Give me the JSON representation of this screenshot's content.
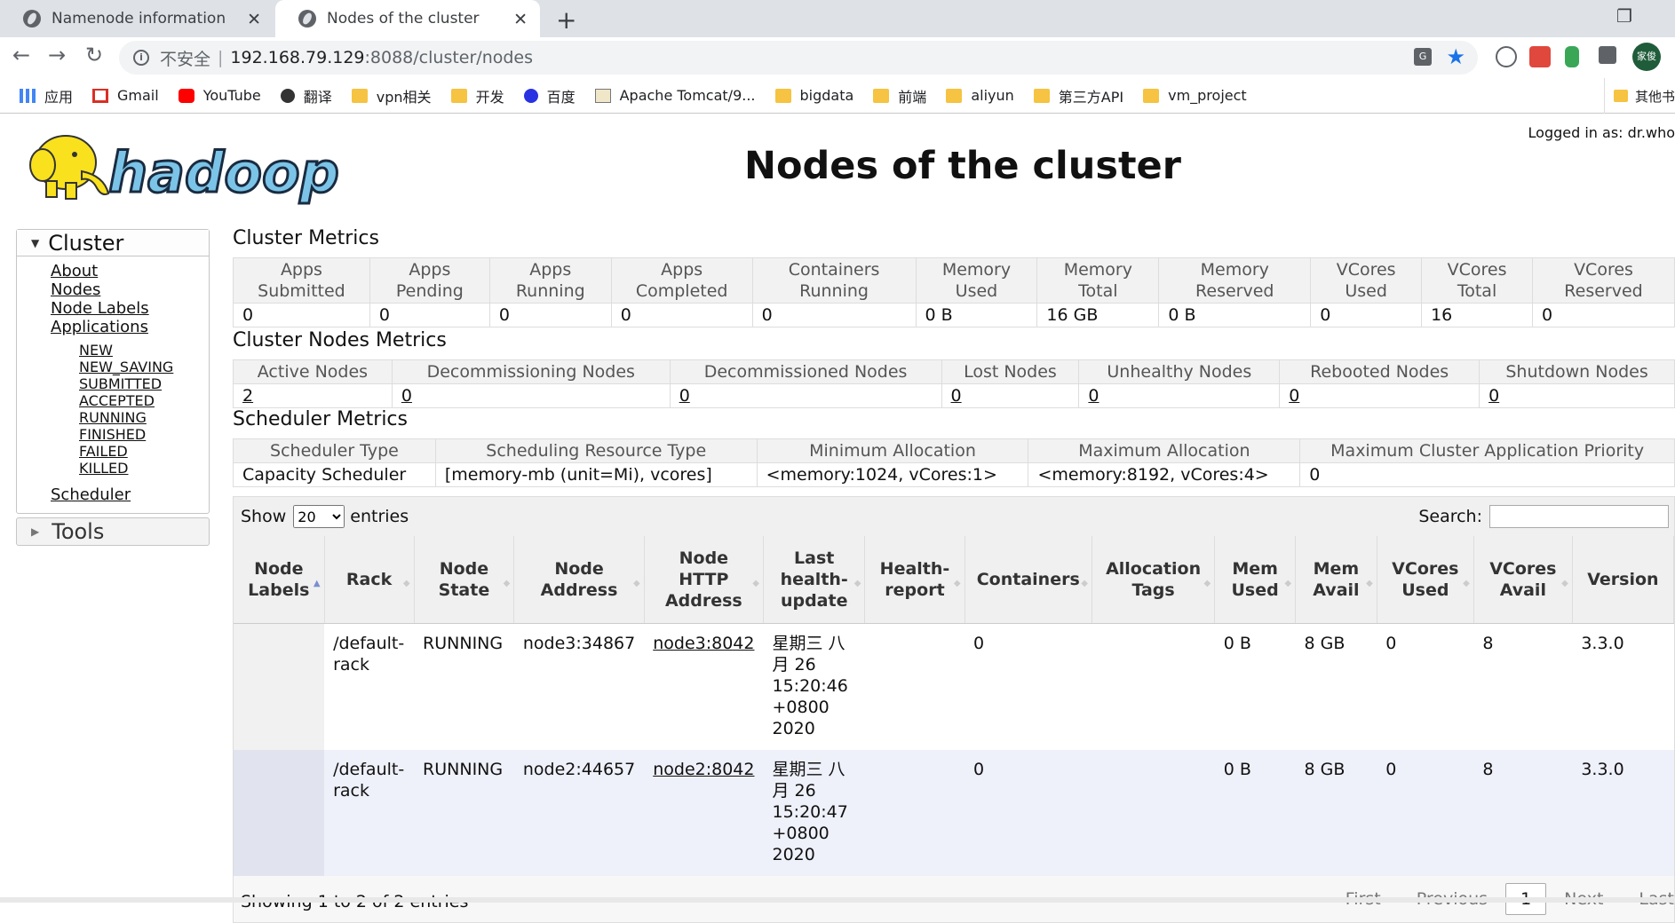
{
  "browser": {
    "tabs": [
      {
        "title": "Namenode information",
        "active": false
      },
      {
        "title": "Nodes of the cluster",
        "active": true
      }
    ],
    "url_insecure_label": "不安全",
    "url_host": "192.168.79.129",
    "url_path": ":8088/cluster/nodes",
    "avatar_text": "家俊",
    "bookmarks": [
      {
        "label": "应用",
        "icon": "apps-grid-icon"
      },
      {
        "label": "Gmail",
        "icon": "gmail-icon"
      },
      {
        "label": "YouTube",
        "icon": "youtube-icon"
      },
      {
        "label": "翻译",
        "icon": "globe-icon"
      },
      {
        "label": "vpn相关",
        "icon": "folder-icon"
      },
      {
        "label": "开发",
        "icon": "folder-icon"
      },
      {
        "label": "百度",
        "icon": "baidu-icon"
      },
      {
        "label": "Apache Tomcat/9...",
        "icon": "tomcat-icon"
      },
      {
        "label": "bigdata",
        "icon": "folder-icon"
      },
      {
        "label": "前端",
        "icon": "folder-icon"
      },
      {
        "label": "aliyun",
        "icon": "folder-icon"
      },
      {
        "label": "第三方API",
        "icon": "folder-icon"
      },
      {
        "label": "vm_project",
        "icon": "folder-icon"
      }
    ],
    "other_bookmarks": "其他书"
  },
  "header": {
    "logged_in": "Logged in as: dr.who",
    "page_title": "Nodes of the cluster"
  },
  "sidebar": {
    "cluster_label": "Cluster",
    "links": [
      "About",
      "Nodes",
      "Node Labels",
      "Applications"
    ],
    "app_states": [
      "NEW",
      "NEW_SAVING",
      "SUBMITTED",
      "ACCEPTED",
      "RUNNING",
      "FINISHED",
      "FAILED",
      "KILLED"
    ],
    "scheduler": "Scheduler",
    "tools_label": "Tools"
  },
  "cluster_metrics": {
    "title": "Cluster Metrics",
    "headers": [
      [
        "Apps",
        "Submitted"
      ],
      [
        "Apps",
        "Pending"
      ],
      [
        "Apps",
        "Running"
      ],
      [
        "Apps",
        "Completed"
      ],
      [
        "Containers",
        "Running"
      ],
      [
        "Memory",
        "Used"
      ],
      [
        "Memory",
        "Total"
      ],
      [
        "Memory",
        "Reserved"
      ],
      [
        "VCores",
        "Used"
      ],
      [
        "VCores",
        "Total"
      ],
      [
        "VCores",
        "Reserved"
      ]
    ],
    "values": [
      "0",
      "0",
      "0",
      "0",
      "0",
      "0 B",
      "16 GB",
      "0 B",
      "0",
      "16",
      "0"
    ]
  },
  "nodes_metrics": {
    "title": "Cluster Nodes Metrics",
    "headers": [
      "Active Nodes",
      "Decommissioning Nodes",
      "Decommissioned Nodes",
      "Lost Nodes",
      "Unhealthy Nodes",
      "Rebooted Nodes",
      "Shutdown Nodes"
    ],
    "values": [
      "2",
      "0",
      "0",
      "0",
      "0",
      "0",
      "0"
    ]
  },
  "scheduler_metrics": {
    "title": "Scheduler Metrics",
    "headers": [
      "Scheduler Type",
      "Scheduling Resource Type",
      "Minimum Allocation",
      "Maximum Allocation",
      "Maximum Cluster Application Priority"
    ],
    "values": [
      "Capacity Scheduler",
      "[memory-mb (unit=Mi), vcores]",
      "<memory:1024, vCores:1>",
      "<memory:8192, vCores:4>",
      "0"
    ]
  },
  "nodes_table": {
    "show_label": "Show",
    "entries_label": "entries",
    "page_size": "20",
    "search_label": "Search:",
    "headers": [
      [
        "Node",
        "Labels"
      ],
      [
        "Rack"
      ],
      [
        "Node",
        "State"
      ],
      [
        "Node",
        "Address"
      ],
      [
        "Node",
        "HTTP",
        "Address"
      ],
      [
        "Last",
        "health-",
        "update"
      ],
      [
        "Health-",
        "report"
      ],
      [
        "Containers"
      ],
      [
        "Allocation",
        "Tags"
      ],
      [
        "Mem",
        "Used"
      ],
      [
        "Mem",
        "Avail"
      ],
      [
        "VCores",
        "Used"
      ],
      [
        "VCores",
        "Avail"
      ],
      [
        "Version"
      ]
    ],
    "rows": [
      {
        "labels": "",
        "rack": [
          "/default-",
          "rack"
        ],
        "state": "RUNNING",
        "address": "node3:34867",
        "http": "node3:8042",
        "update": [
          "星期三 八",
          "月 26",
          "15:20:46",
          "+0800",
          "2020"
        ],
        "health": "",
        "containers": "0",
        "tags": "",
        "mem_used": "0 B",
        "mem_avail": "8 GB",
        "vc_used": "0",
        "vc_avail": "8",
        "version": "3.3.0"
      },
      {
        "labels": "",
        "rack": [
          "/default-",
          "rack"
        ],
        "state": "RUNNING",
        "address": "node2:44657",
        "http": "node2:8042",
        "update": [
          "星期三 八",
          "月 26",
          "15:20:47",
          "+0800",
          "2020"
        ],
        "health": "",
        "containers": "0",
        "tags": "",
        "mem_used": "0 B",
        "mem_avail": "8 GB",
        "vc_used": "0",
        "vc_avail": "8",
        "version": "3.3.0"
      }
    ],
    "info": "Showing 1 to 2 of 2 entries",
    "pager": {
      "first": "First",
      "previous": "Previous",
      "current": "1",
      "next": "Next",
      "last": "Last"
    }
  }
}
